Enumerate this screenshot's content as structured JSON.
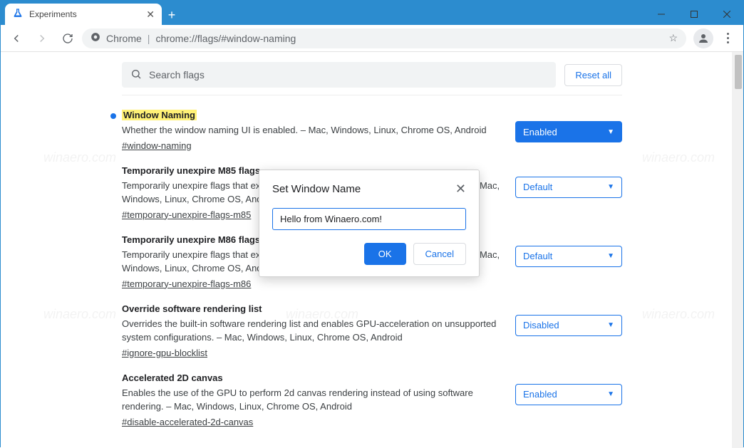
{
  "tab": {
    "title": "Experiments"
  },
  "omnibox": {
    "prefix": "Chrome",
    "url": "chrome://flags/#window-naming"
  },
  "search": {
    "placeholder": "Search flags",
    "reset": "Reset all"
  },
  "dialog": {
    "title": "Set Window Name",
    "value": "Hello from Winaero.com!",
    "ok": "OK",
    "cancel": "Cancel"
  },
  "flags": [
    {
      "title": "Window Naming",
      "desc": "Whether the window naming UI is enabled. – Mac, Windows, Linux, Chrome OS, Android",
      "anchor": "#window-naming",
      "state": "Enabled",
      "highlighted": true,
      "modified": true
    },
    {
      "title": "Temporarily unexpire M85 flags.",
      "desc": "Temporarily unexpire flags that expired as of M85. These flags will be removed soon. – Mac, Windows, Linux, Chrome OS, Android",
      "anchor": "#temporary-unexpire-flags-m85",
      "state": "Default"
    },
    {
      "title": "Temporarily unexpire M86 flags.",
      "desc": "Temporarily unexpire flags that expired as of M86. These flags will be removed soon. – Mac, Windows, Linux, Chrome OS, Android",
      "anchor": "#temporary-unexpire-flags-m86",
      "state": "Default"
    },
    {
      "title": "Override software rendering list",
      "desc": "Overrides the built-in software rendering list and enables GPU-acceleration on unsupported system configurations. – Mac, Windows, Linux, Chrome OS, Android",
      "anchor": "#ignore-gpu-blocklist",
      "state": "Disabled"
    },
    {
      "title": "Accelerated 2D canvas",
      "desc": "Enables the use of the GPU to perform 2d canvas rendering instead of using software rendering. – Mac, Windows, Linux, Chrome OS, Android",
      "anchor": "#disable-accelerated-2d-canvas",
      "state": "Enabled"
    }
  ],
  "watermark": "winaero.com"
}
